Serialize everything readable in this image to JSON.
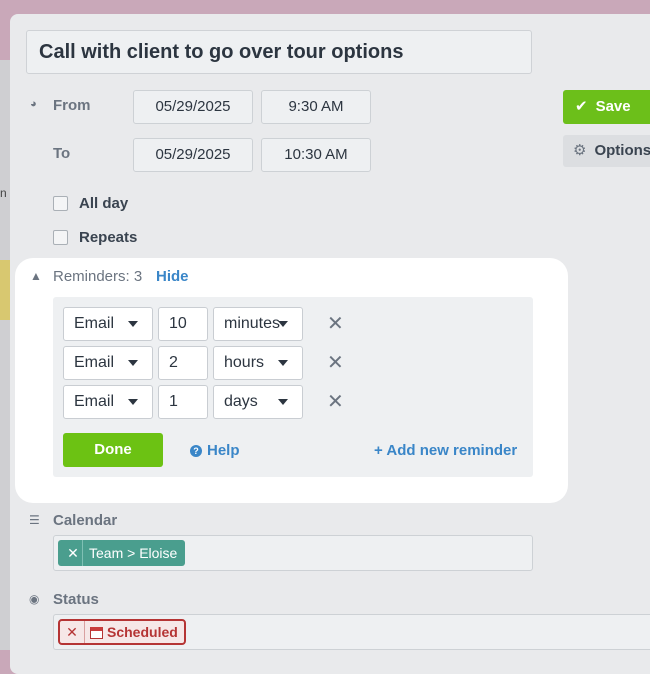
{
  "event": {
    "title": "Call with client to go over tour options"
  },
  "time": {
    "from_label": "From",
    "to_label": "To",
    "from_date": "05/29/2025",
    "from_time": "9:30 AM",
    "to_date": "05/29/2025",
    "to_time": "10:30 AM"
  },
  "actions": {
    "save_label": "Save",
    "options_label": "Options"
  },
  "checks": {
    "all_day_label": "All day",
    "repeats_label": "Repeats"
  },
  "reminders": {
    "header": "Reminders: 3",
    "hide_label": "Hide",
    "rows": [
      {
        "method": "Email",
        "amount": "10",
        "unit": "minutes"
      },
      {
        "method": "Email",
        "amount": "2",
        "unit": "hours"
      },
      {
        "method": "Email",
        "amount": "1",
        "unit": "days"
      }
    ],
    "done_label": "Done",
    "help_label": "Help",
    "add_label": "+ Add new reminder"
  },
  "calendar": {
    "label": "Calendar",
    "tag": "Team > Eloise"
  },
  "status": {
    "label": "Status",
    "tag": "Scheduled"
  },
  "background": {
    "edge_text": "n"
  },
  "colors": {
    "save": "#6cbf1a",
    "done": "#6cc213",
    "link": "#3a86c8",
    "calendar_tag": "#4a9e8e",
    "status_tag": "#b53434"
  }
}
